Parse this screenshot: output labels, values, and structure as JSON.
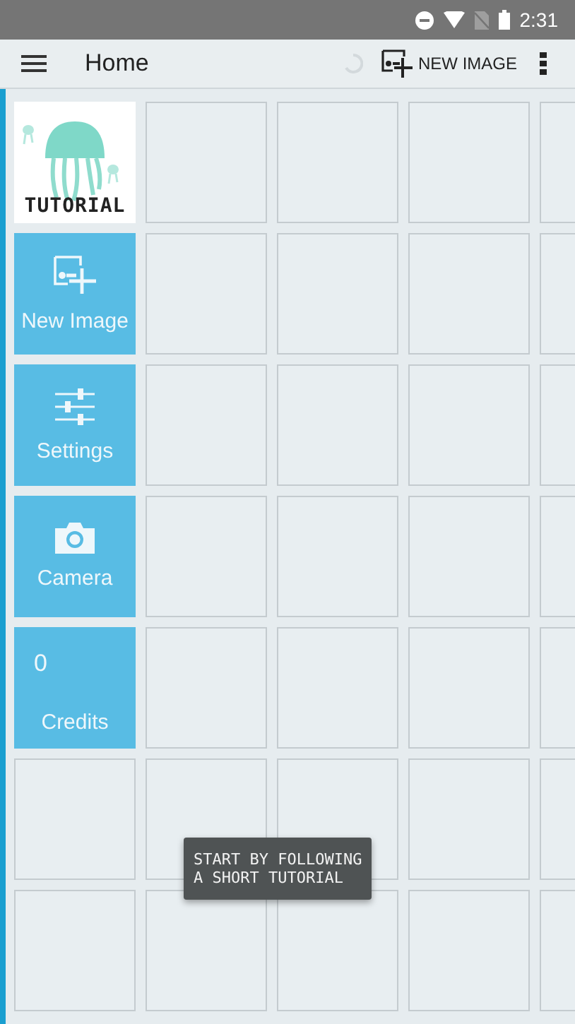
{
  "status_bar": {
    "time": "2:31"
  },
  "app_bar": {
    "title": "Home",
    "action": "NEW IMAGE"
  },
  "tiles": [
    {
      "kind": "tutorial",
      "label": "TUTORIAL"
    },
    {
      "kind": "new_image",
      "label": "New Image"
    },
    {
      "kind": "settings",
      "label": "Settings"
    },
    {
      "kind": "camera",
      "label": "Camera"
    },
    {
      "kind": "credits",
      "label": "Credits",
      "count": "0"
    }
  ],
  "tooltip": {
    "text": "START BY FOLLOWING\nA SHORT TUTORIAL"
  }
}
